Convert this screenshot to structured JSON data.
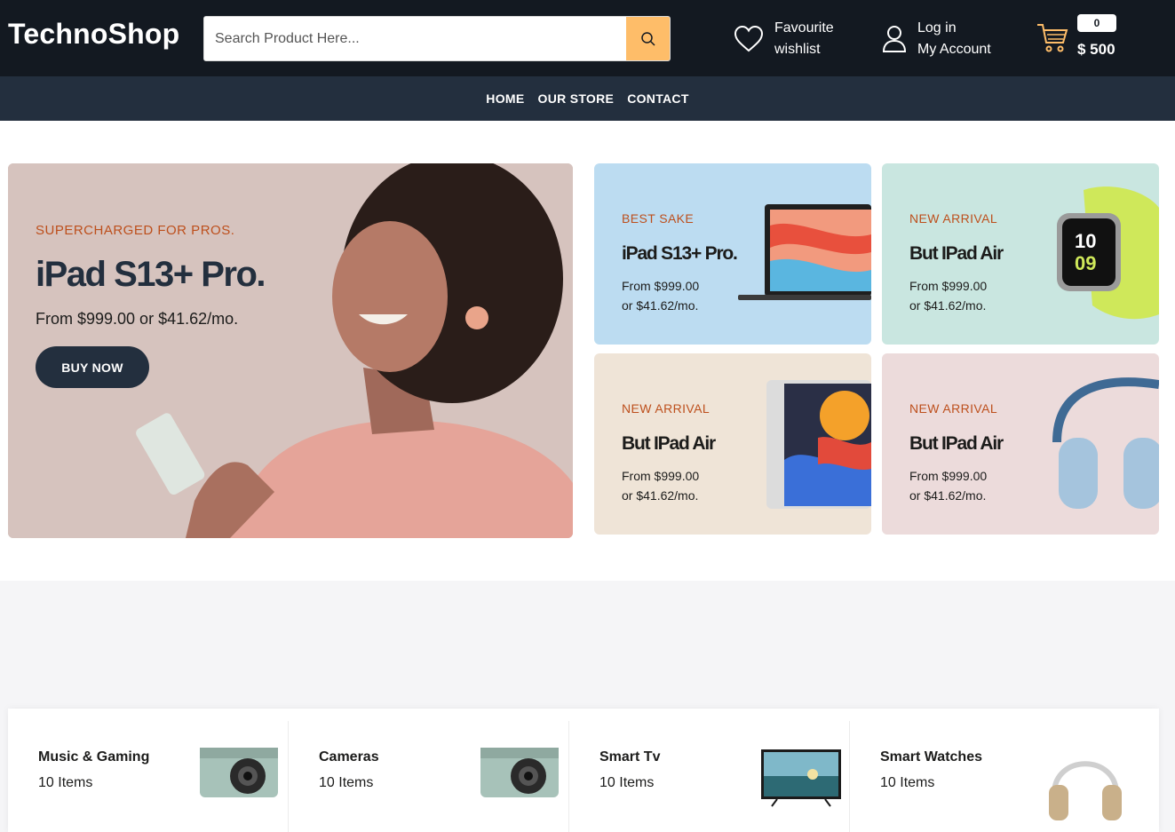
{
  "header": {
    "logo": "TechnoShop",
    "search_placeholder": "Search Product Here...",
    "wishlist_line1": "Favourite",
    "wishlist_line2": "wishlist",
    "account_line1": "Log in",
    "account_line2": "My Account",
    "cart_count": "0",
    "cart_total": "$ 500",
    "accent_color": "#febd69"
  },
  "nav": {
    "items": [
      {
        "label": "HOME"
      },
      {
        "label": "OUR STORE"
      },
      {
        "label": "CONTACT"
      }
    ]
  },
  "hero": {
    "eyebrow": "SUPERCHARGED FOR PROS.",
    "title": "iPad S13+ Pro.",
    "price": "From $999.00 or $41.62/mo.",
    "button": "BUY NOW"
  },
  "promo_cards": [
    {
      "eyebrow": "BEST SAKE",
      "title": "iPad S13+ Pro.",
      "price_line1": "From $999.00",
      "price_line2": "or $41.62/mo.",
      "image": "laptop-image"
    },
    {
      "eyebrow": "NEW ARRIVAL",
      "title": "But IPad Air",
      "price_line1": "From $999.00",
      "price_line2": "or $41.62/mo.",
      "image": "smartwatch-image"
    },
    {
      "eyebrow": "NEW ARRIVAL",
      "title": "But IPad Air",
      "price_line1": "From $999.00",
      "price_line2": "or $41.62/mo.",
      "image": "tablet-image"
    },
    {
      "eyebrow": "NEW ARRIVAL",
      "title": "But IPad Air",
      "price_line1": "From $999.00",
      "price_line2": "or $41.62/mo.",
      "image": "headphones-image"
    }
  ],
  "categories": [
    {
      "name": "Music & Gaming",
      "count": "10 Items",
      "image": "camera-image"
    },
    {
      "name": "Cameras",
      "count": "10 Items",
      "image": "camera-image"
    },
    {
      "name": "Smart Tv",
      "count": "10 Items",
      "image": "tv-image"
    },
    {
      "name": "Smart Watches",
      "count": "10 Items",
      "image": "headphones-image"
    }
  ]
}
